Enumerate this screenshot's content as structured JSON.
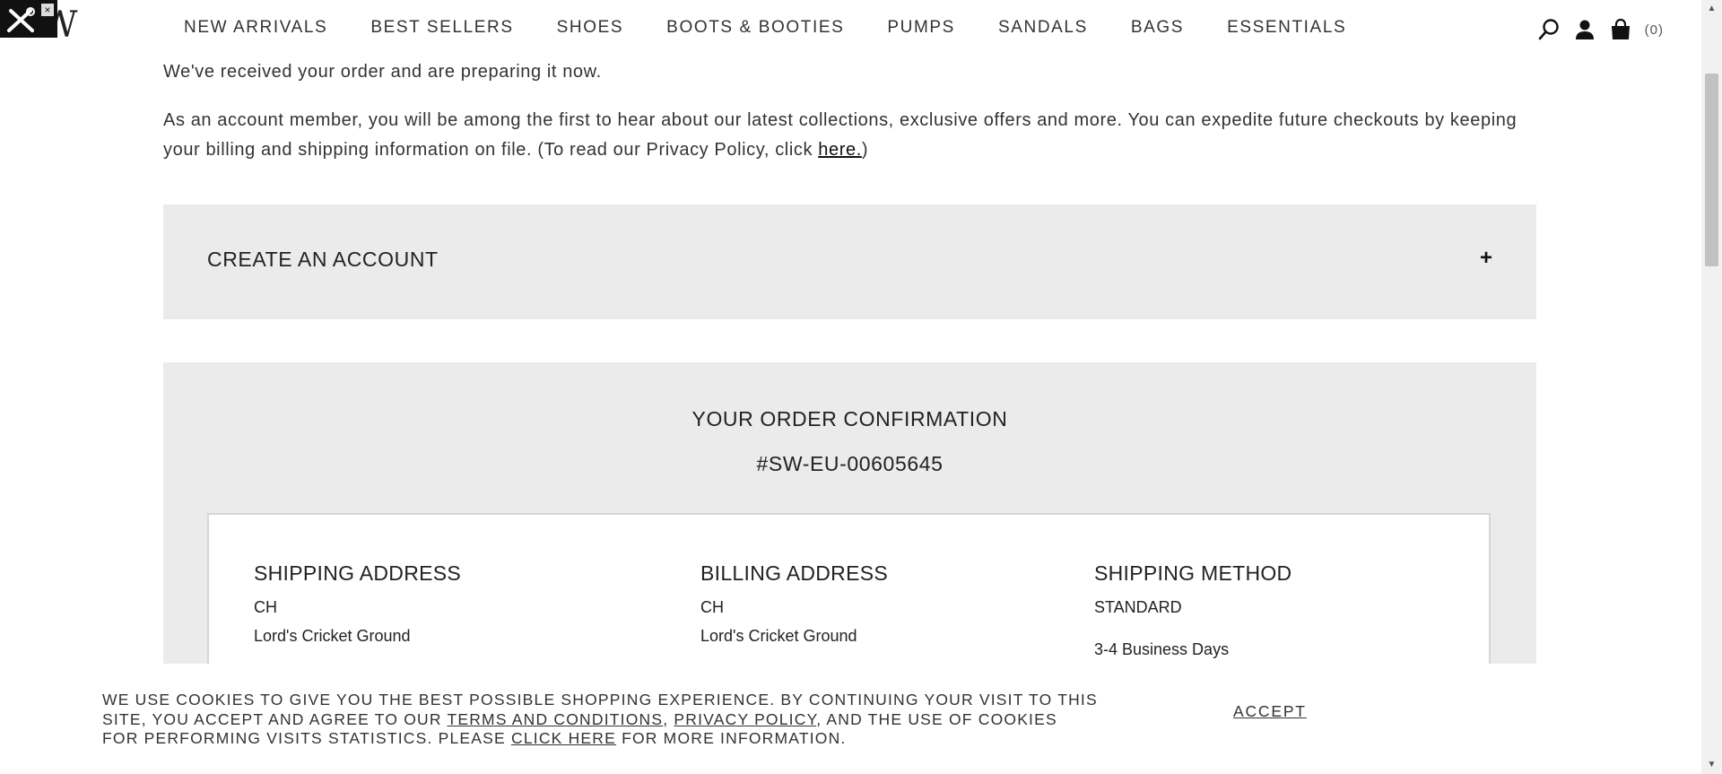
{
  "header": {
    "logo": "SW",
    "nav": [
      "NEW ARRIVALS",
      "BEST SELLERS",
      "SHOES",
      "BOOTS & BOOTIES",
      "PUMPS",
      "SANDALS",
      "BAGS",
      "ESSENTIALS"
    ],
    "cart_count": "(0)"
  },
  "intro": {
    "line1": "We've received your order and are preparing it now.",
    "line2": "As an account member, you will be among the first to hear about our latest collections, exclusive offers and more. You can expedite future checkouts by keeping your billing and shipping information on file. (To read our Privacy Policy, click ",
    "link": "here.",
    "line2_end": ")"
  },
  "create_account": {
    "title": "CREATE AN ACCOUNT",
    "toggle": "+"
  },
  "order": {
    "title": "YOUR ORDER CONFIRMATION",
    "number": "#SW-EU-00605645",
    "shipping_address": {
      "heading": "SHIPPING ADDRESS",
      "line1": "CH",
      "line2": "Lord's Cricket Ground"
    },
    "billing_address": {
      "heading": "BILLING ADDRESS",
      "line1": "CH",
      "line2": "Lord's Cricket Ground"
    },
    "shipping_method": {
      "heading": "SHIPPING METHOD",
      "line1": "STANDARD",
      "line2": "3-4 Business Days"
    }
  },
  "cookie": {
    "text1": "WE USE COOKIES TO GIVE YOU THE BEST POSSIBLE SHOPPING EXPERIENCE. BY CONTINUING YOUR VISIT TO THIS SITE, YOU ACCEPT AND AGREE TO OUR ",
    "terms": "TERMS AND CONDITIONS",
    "sep": ", ",
    "privacy": "PRIVACY POLICY",
    "text2": ", AND THE USE OF COOKIES FOR PERFORMING VISITS STATISTICS. PLEASE ",
    "click_here": "CLICK HERE",
    "text3": " FOR MORE INFORMATION.",
    "accept": "ACCEPT"
  },
  "icons": [
    "tools-icon",
    "close-icon",
    "search-icon",
    "account-icon",
    "bag-icon",
    "plus-icon"
  ]
}
